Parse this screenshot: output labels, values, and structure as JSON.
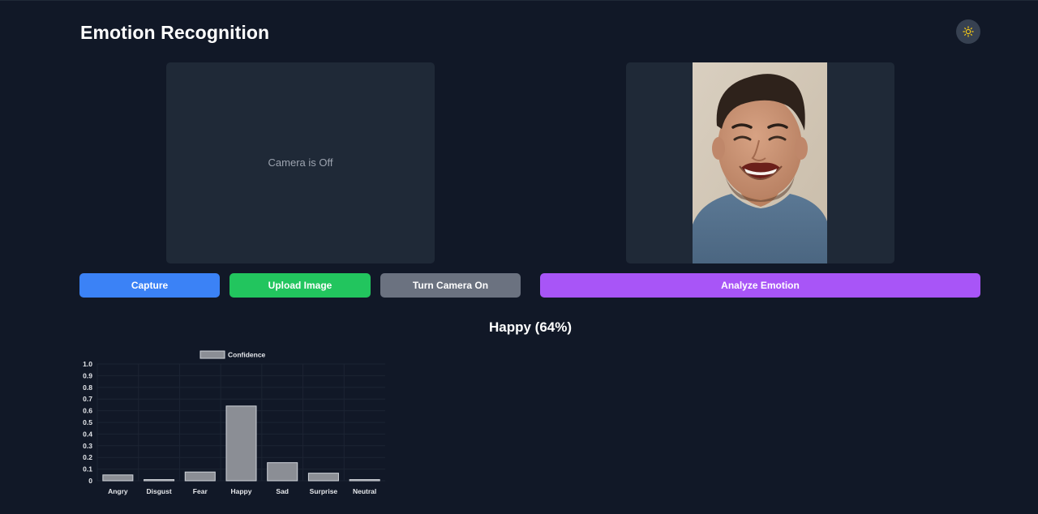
{
  "app": {
    "title": "Emotion Recognition"
  },
  "header": {
    "theme_toggle_icon": "sun-icon",
    "theme_toggle_color": "#facc15"
  },
  "camera_panel": {
    "status_text": "Camera is Off"
  },
  "preview_panel": {
    "image_description": "smiling-man-portrait"
  },
  "buttons": {
    "capture": "Capture",
    "upload": "Upload Image",
    "toggle_camera": "Turn Camera On",
    "analyze": "Analyze Emotion"
  },
  "colors": {
    "background": "#111827",
    "panel": "#1f2937",
    "capture": "#3b82f6",
    "upload": "#22c55e",
    "toggle_camera": "#6b7280",
    "analyze": "#a855f7",
    "bar_fill": "#8b8e95",
    "bar_stroke": "#d1d5db"
  },
  "result": {
    "text": "Happy (64%)"
  },
  "chart_data": {
    "type": "bar",
    "categories": [
      "Angry",
      "Disgust",
      "Fear",
      "Happy",
      "Sad",
      "Surprise",
      "Neutral"
    ],
    "series": [
      {
        "name": "Confidence",
        "values": [
          0.05,
          0.01,
          0.075,
          0.64,
          0.155,
          0.065,
          0.01
        ]
      }
    ],
    "ylim": [
      0,
      1.0
    ],
    "yticks": [
      "0",
      "0.1",
      "0.2",
      "0.3",
      "0.4",
      "0.5",
      "0.6",
      "0.7",
      "0.8",
      "0.9",
      "1.0"
    ],
    "legend_position": "top",
    "grid": true
  }
}
